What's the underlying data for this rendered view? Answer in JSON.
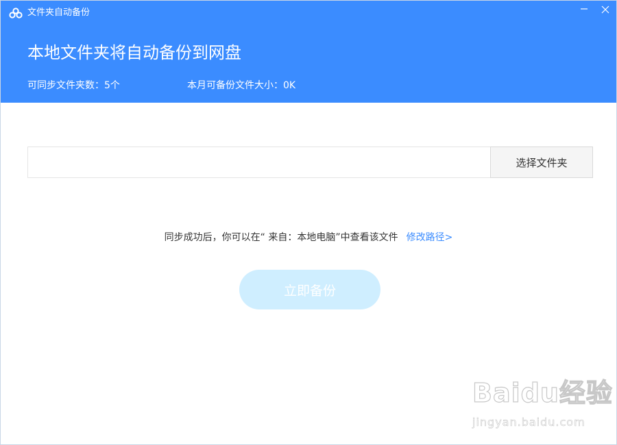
{
  "window": {
    "title": "文件夹自动备份",
    "app_icon": "baidu-netdisk-cloud-icon",
    "minimize_icon": "minimize-icon",
    "close_icon": "close-icon"
  },
  "header": {
    "headline": "本地文件夹将自动备份到网盘",
    "sync_folder_count": "可同步文件夹数：5个",
    "monthly_backup_size": "本月可备份文件大小：0K"
  },
  "folder_picker": {
    "path_value": "",
    "path_placeholder": "",
    "choose_button": "选择文件夹"
  },
  "hint": {
    "text": "同步成功后，你可以在“ 来自：本地电脑”中查看该文件",
    "modify_path_link": "修改路径>"
  },
  "backup_button": {
    "label": "立即备份"
  },
  "watermark": {
    "logo": "Baidu经验",
    "url": "jingyan.baidu.com"
  },
  "colors": {
    "header_bg": "#3b8cff",
    "link": "#3b8cff",
    "disabled_button": "#cfeeff"
  }
}
